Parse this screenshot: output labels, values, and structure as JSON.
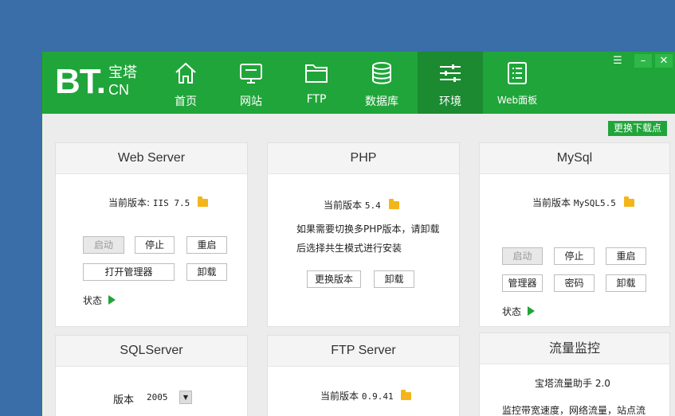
{
  "app": {
    "logo_main": "BT.",
    "logo_cn1": "宝塔",
    "logo_cn2": "CN"
  },
  "nav": [
    {
      "label": "首页",
      "icon": "home-icon"
    },
    {
      "label": "网站",
      "icon": "monitor-icon"
    },
    {
      "label": "FTP",
      "icon": "folder-icon"
    },
    {
      "label": "数据库",
      "icon": "database-icon"
    },
    {
      "label": "环境",
      "icon": "sliders-icon",
      "active": true
    },
    {
      "label": "Web面板",
      "icon": "list-icon"
    }
  ],
  "window_controls": {
    "menu": "☰",
    "minimize": "–",
    "close": "✕"
  },
  "toolbar": {
    "change_download_node": "更换下载点"
  },
  "webserver": {
    "title": "Web Server",
    "version_label": "当前版本:",
    "version_value": "IIS 7.5",
    "btn_start": "启动",
    "btn_stop": "停止",
    "btn_restart": "重启",
    "btn_open_manager": "打开管理器",
    "btn_uninstall": "卸载",
    "status_label": "状态"
  },
  "php": {
    "title": "PHP",
    "version_label": "当前版本",
    "version_value": "5.4",
    "note_line1": "如果需要切换多PHP版本，请卸载",
    "note_line2": "后选择共生模式进行安装",
    "btn_change_version": "更换版本",
    "btn_uninstall": "卸载"
  },
  "mysql": {
    "title": "MySql",
    "version_label": "当前版本",
    "version_value": "MySQL5.5",
    "btn_start": "启动",
    "btn_stop": "停止",
    "btn_restart": "重启",
    "btn_manager": "管理器",
    "btn_password": "密码",
    "btn_uninstall": "卸载",
    "status_label": "状态"
  },
  "sqlserver": {
    "title": "SQLServer",
    "version_label": "版本",
    "version_value": "2005"
  },
  "ftpserver": {
    "title": "FTP Server",
    "version_label": "当前版本",
    "version_value": "0.9.41"
  },
  "traffic": {
    "title": "流量监控",
    "subtitle": "宝塔流量助手 2.0",
    "desc": "监控带宽速度，网络流量，站点流"
  },
  "colors": {
    "brand_green": "#20a53a",
    "active_tab": "#1b8a31",
    "desktop_blue": "#3a6ea8"
  }
}
